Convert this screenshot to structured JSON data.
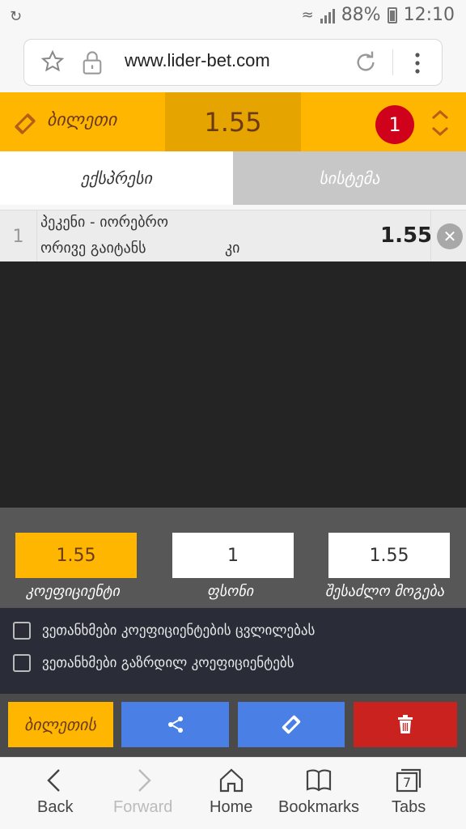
{
  "status_bar": {
    "battery": "88%",
    "time": "12:10"
  },
  "browser": {
    "url": "www.lider-bet.com"
  },
  "ticket": {
    "title": "ბილეთი",
    "total_coefficient": "1.55",
    "count": "1"
  },
  "tabs": [
    {
      "label": "ექსპრესი",
      "active": true
    },
    {
      "label": "სისტემა",
      "active": false
    }
  ],
  "bets": [
    {
      "index": "1",
      "match": "პეკენი - იორებრო",
      "market": "ორივე გაიტანს",
      "pick": "კი",
      "odd": "1.55"
    }
  ],
  "summary": {
    "coefficient_value": "1.55",
    "stake_value": "1",
    "potential_win_value": "1.55",
    "coefficient_label": "კოეფიციენტი",
    "stake_label": "ფსონი",
    "potential_win_label": "შესაძლო მოგება"
  },
  "agreements": [
    {
      "label": "ვეთანხმები კოეფიციენტების ცვლილებას",
      "checked": false
    },
    {
      "label": "ვეთანხმები გაზრდილ კოეფიციენტებს",
      "checked": false
    }
  ],
  "actions": {
    "save_label": "ბილეთის"
  },
  "bottom_nav": [
    {
      "label": "Back",
      "icon": "back-icon",
      "enabled": true
    },
    {
      "label": "Forward",
      "icon": "forward-icon",
      "enabled": false
    },
    {
      "label": "Home",
      "icon": "home-icon",
      "enabled": true
    },
    {
      "label": "Bookmarks",
      "icon": "bookmarks-icon",
      "enabled": true
    },
    {
      "label": "Tabs",
      "icon": "tabs-icon",
      "enabled": true,
      "count": "7"
    }
  ],
  "colors": {
    "accent": "#ffb600",
    "accent_dark": "#e6a400",
    "badge_red": "#d0021b",
    "action_blue": "#4a7fe6",
    "delete_red": "#c9221f"
  }
}
